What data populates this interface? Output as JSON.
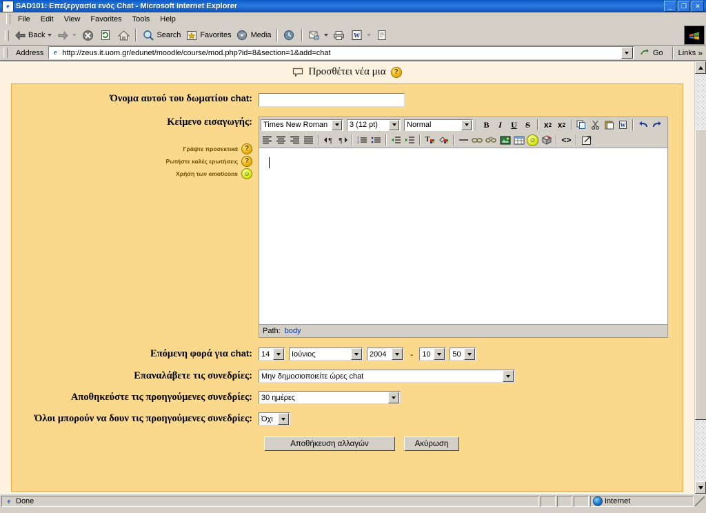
{
  "window": {
    "title": "SAD101: Επεξεργασία ενός Chat - Microsoft Internet Explorer",
    "minimize": "_",
    "maximize": "❐",
    "close": "✕"
  },
  "menubar": [
    {
      "label": "File"
    },
    {
      "label": "Edit"
    },
    {
      "label": "View"
    },
    {
      "label": "Favorites"
    },
    {
      "label": "Tools"
    },
    {
      "label": "Help"
    }
  ],
  "toolbar": {
    "back": "Back",
    "search": "Search",
    "favorites": "Favorites",
    "media": "Media"
  },
  "address": {
    "label": "Address",
    "url": "http://zeus.it.uom.gr/edunet/moodle/course/mod.php?id=8&section=1&add=chat",
    "go": "Go",
    "links": "Links"
  },
  "page": {
    "heading": "Προσθέτει νέα μια",
    "form": {
      "name_label_pre": "Όνομα αυτού του δωματίου",
      "name_label_lat": "chat",
      "name_label_colon": ":",
      "name_value": "",
      "intro_label": "Κείμενο εισαγωγής:",
      "help_links": [
        {
          "text": "Γράψτε προσεκτικά",
          "icon": "help-icon"
        },
        {
          "text": "Ρωτήστε καλές ερωτήσεις",
          "icon": "help-icon"
        },
        {
          "text": "Χρήση των emoticons",
          "icon": "smiley-icon"
        }
      ],
      "editor": {
        "font_family": "Times New Roman",
        "font_size": "3 (12 pt)",
        "paragraph_style": "Normal",
        "path_label": "Path:",
        "path_value": "body",
        "content": ""
      },
      "next_time_label_pre": "Επόμενη φορά για",
      "next_time_label_lat": "chat",
      "next_time_label_colon": ":",
      "day": "14",
      "month": "Ιούνιος",
      "year": "2004",
      "time_sep": "-",
      "hour": "10",
      "minute": "50",
      "repeat_label": "Επαναλάβετε τις συνεδρίες:",
      "repeat_value": "Μην δημοσιοποιείτε ώρες chat",
      "save_sessions_label": "Αποθηκεύστε τις προηγούμενες συνεδρίες:",
      "save_sessions_value": "30 ημέρες",
      "everyone_view_label": "Όλοι μπορούν να δουν τις προηγούμενες συνεδρίες:",
      "everyone_view_value": "Όχι",
      "submit_button": "Αποθήκευση αλλαγών",
      "cancel_button": "Ακύρωση"
    }
  },
  "statusbar": {
    "message": "Done",
    "zone": "Internet"
  },
  "colors": {
    "page_bg": "#FDF2DF",
    "box_bg": "#FBD98C",
    "box_border": "#E8A94B",
    "chrome": "#d4d0c8",
    "title_blue": "#0a59c8",
    "link": "#0033cc"
  }
}
